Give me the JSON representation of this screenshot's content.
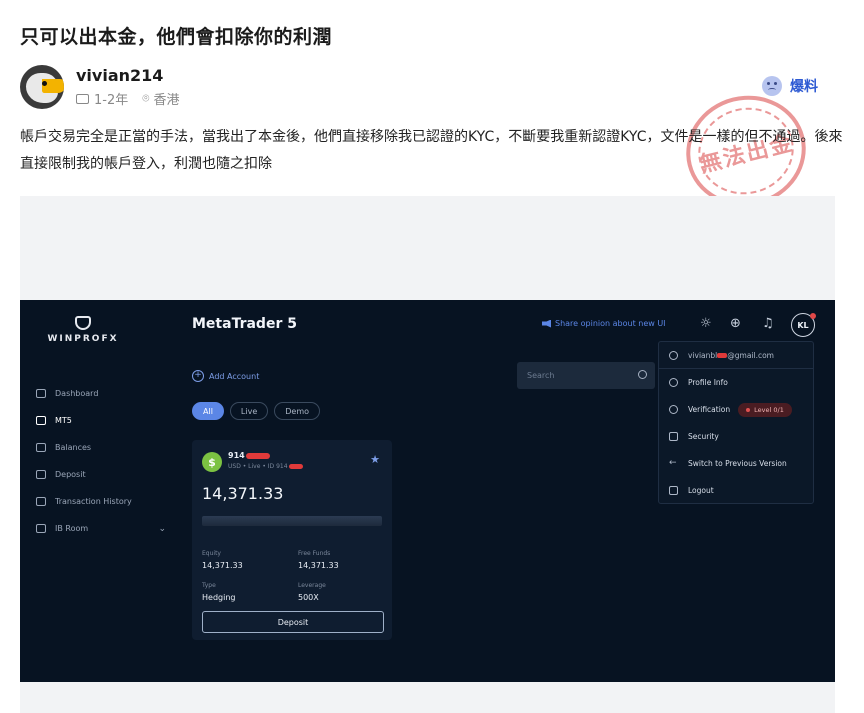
{
  "post": {
    "title": "只可以出本金，他們會扣除你的利潤",
    "author": "vivian214",
    "duration": "1-2年",
    "location": "香港",
    "expose_label": "爆料",
    "stamp_text": "無法出金",
    "body": "帳戶交易完全是正當的手法，當我出了本金後，他們直接移除我已認證的KYC，不斷要我重新認證KYC，文件是一樣的但不通過。後來直接限制我的帳戶登入，利潤也隨之扣除"
  },
  "screenshot": {
    "logo_text": "WINPROFX",
    "app_title": "MetaTrader 5",
    "share_text": "Share opinion about new UI",
    "avatar_initials": "KL",
    "nav": [
      {
        "label": "Dashboard",
        "active": false,
        "icon": "dashboard-icon"
      },
      {
        "label": "MT5",
        "active": true,
        "icon": "mt5-icon"
      },
      {
        "label": "Balances",
        "active": false,
        "icon": "wallet-icon"
      },
      {
        "label": "Deposit",
        "active": false,
        "icon": "deposit-icon"
      },
      {
        "label": "Transaction History",
        "active": false,
        "icon": "history-icon"
      },
      {
        "label": "IB Room",
        "active": false,
        "icon": "ib-room-icon"
      }
    ],
    "add_account": "Add Account",
    "search_placeholder": "Search",
    "filters": [
      "All",
      "Live",
      "Demo"
    ],
    "account": {
      "number": "914",
      "subtitle": "USD • Live • ID 914",
      "balance": "14,371.33",
      "equity_label": "Equity",
      "equity": "14,371.33",
      "free_funds_label": "Free Funds",
      "free_funds": "14,371.33",
      "type_label": "Type",
      "type": "Hedging",
      "leverage_label": "Leverage",
      "leverage": "500X",
      "deposit_label": "Deposit"
    },
    "menu": {
      "email_prefix": "vivianbl",
      "email_suffix": "@gmail.com",
      "profile": "Profile Info",
      "verification": "Verification",
      "level": "Level 0/1",
      "security": "Security",
      "switch": "Switch to Previous Version",
      "logout": "Logout"
    }
  }
}
